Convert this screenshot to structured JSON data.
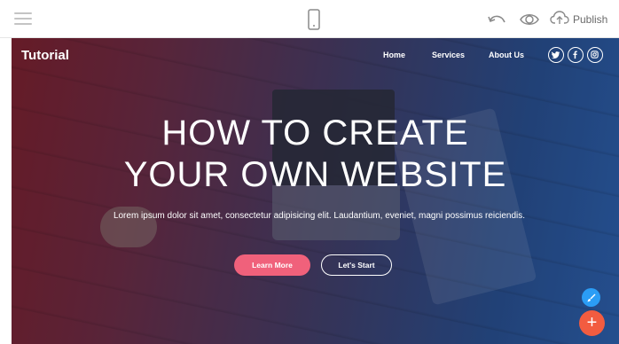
{
  "toolbar": {
    "publish_label": "Publish",
    "icons": [
      "menu-icon",
      "mobile-device-icon",
      "undo-icon",
      "eye-icon",
      "cloud-upload-icon"
    ]
  },
  "site": {
    "brand": "Tutorial",
    "nav": {
      "home": "Home",
      "services": "Services",
      "about": "About Us"
    },
    "social": [
      "twitter-icon",
      "facebook-icon",
      "instagram-icon"
    ]
  },
  "hero": {
    "headline_line1": "HOW TO CREATE",
    "headline_line2": "YOUR OWN WEBSITE",
    "tagline": "Lorem ipsum dolor sit amet, consectetur adipisicing elit. Laudantium, eveniet, magni possimus reiciendis.",
    "primary_button": "Learn More",
    "secondary_button": "Let's Start"
  },
  "fabs": {
    "add_label": "+",
    "edit_icon": "paint-brush-icon"
  },
  "colors": {
    "accent_pink": "#f0617b",
    "fab_red": "#f25c40",
    "fab_blue": "#2b9df5",
    "toolbar_icon": "#9a9a9a"
  }
}
